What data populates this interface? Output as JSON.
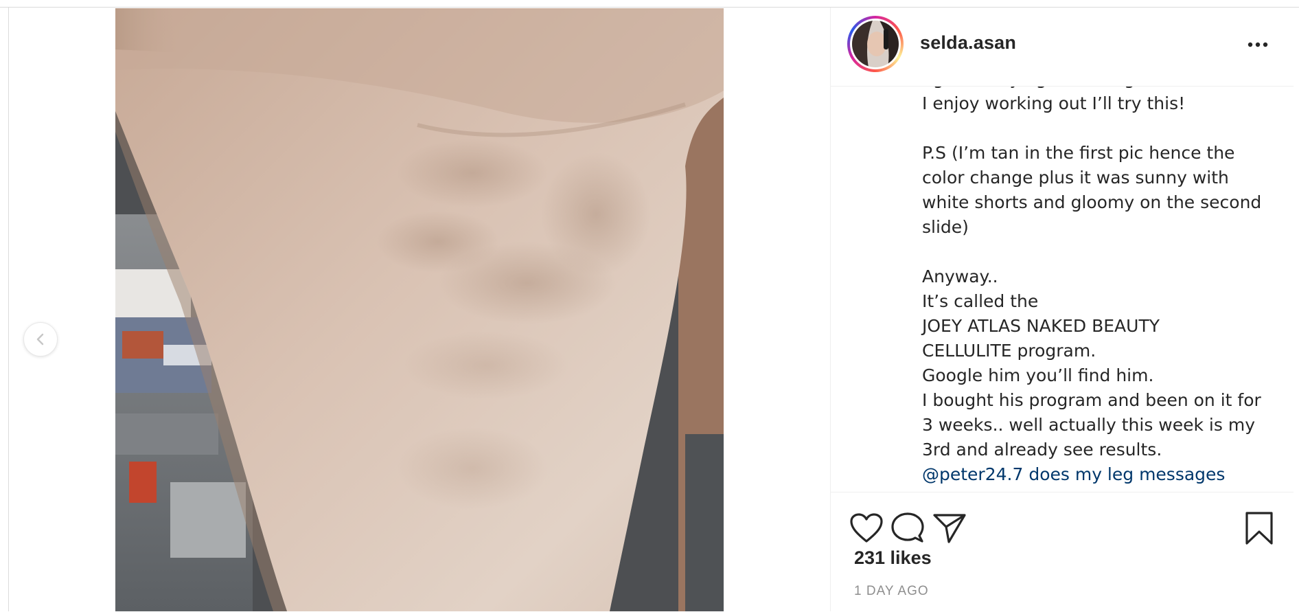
{
  "post": {
    "username": "selda.asan",
    "more_icon": "more-horizontal-icon",
    "prev_icon": "chevron-left-icon",
    "caption_lines": [
      "figured hey I got nothing to loose since",
      "I enjoy working out I’ll try this!",
      "",
      "P.S (I’m tan in the first pic hence the",
      "color change plus it was sunny with",
      "white shorts and gloomy on the second",
      "slide)",
      "",
      "Anyway..",
      "It’s called the",
      "JOEY ATLAS NAKED BEAUTY",
      "CELLULITE program.",
      "Google him you’ll find him.",
      "I bought his program and been on it for",
      "3 weeks.. well actually this week is my",
      "3rd and already see results.",
      "@peter24.7 does my leg messages"
    ],
    "actions": {
      "like_icon": "heart-icon",
      "comment_icon": "comment-icon",
      "share_icon": "paper-plane-icon",
      "save_icon": "bookmark-icon"
    },
    "likes": "231 likes",
    "timestamp": "1 DAY AGO"
  }
}
